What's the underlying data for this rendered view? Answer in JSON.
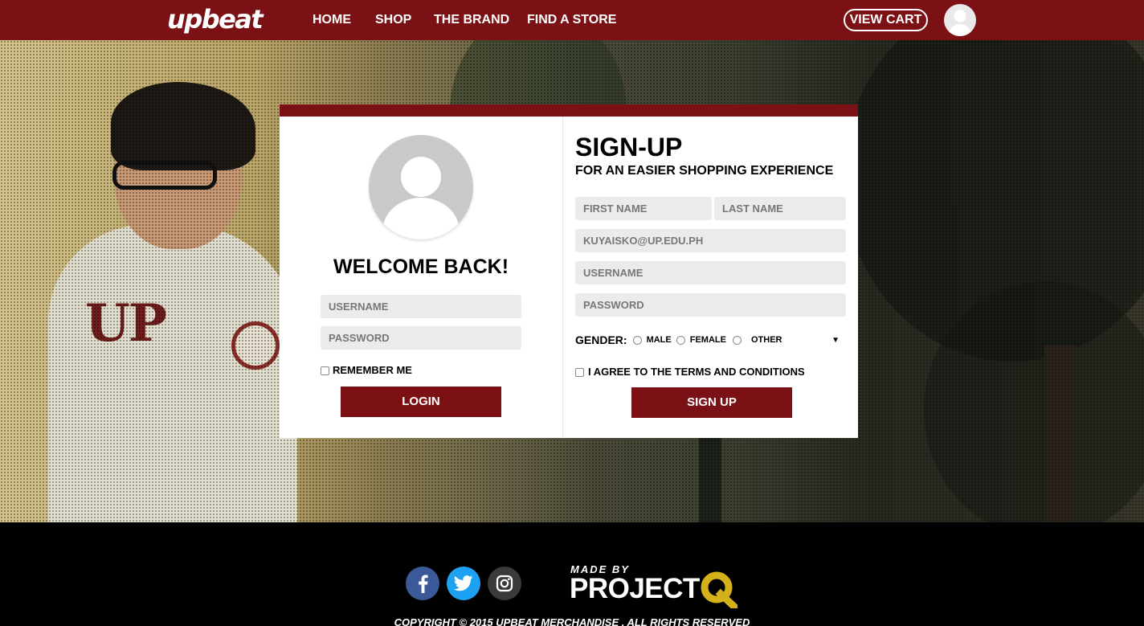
{
  "colors": {
    "brand": "#7b1114",
    "field_bg": "#ebebeb",
    "footer_bg": "#000000",
    "facebook": "#3b5998",
    "twitter": "#1da1f2",
    "instagram": "#3a3a3a",
    "q_yellow": "#d4b11a"
  },
  "nav": {
    "logo": "upbeat",
    "links": [
      "HOME",
      "SHOP",
      "THE BRAND",
      "FIND A STORE"
    ],
    "view_cart": "VIEW CART",
    "avatar_icon": "user-avatar-icon"
  },
  "login": {
    "avatar_icon": "user-silhouette-icon",
    "title": "WELCOME BACK!",
    "username_placeholder": "USERNAME",
    "password_placeholder": "PASSWORD",
    "remember_label": "REMEMBER ME",
    "login_button": "LOGIN"
  },
  "signup": {
    "title": "SIGN-UP",
    "subtitle": "FOR AN EASIER SHOPPING EXPERIENCE",
    "first_name_placeholder": "FIRST NAME",
    "last_name_placeholder": "LAST NAME",
    "email_placeholder": "KUYAISKO@UP.EDU.PH",
    "username_placeholder": "USERNAME",
    "password_placeholder": "PASSWORD",
    "gender_label": "GENDER:",
    "gender_options": [
      "MALE",
      "FEMALE",
      "OTHER"
    ],
    "terms_label": "I AGREE TO THE TERMS AND CONDITIONS",
    "signup_button": "SIGN UP"
  },
  "footer": {
    "social_icons": [
      "facebook-icon",
      "twitter-icon",
      "instagram-icon"
    ],
    "made_by": "MADE BY",
    "project_text": "PROJECT",
    "project_letter": "Q",
    "copyright": "COPYRIGHT © 2015 UPBEAT MERCHANDISE . ALL RIGHTS RESERVED"
  }
}
